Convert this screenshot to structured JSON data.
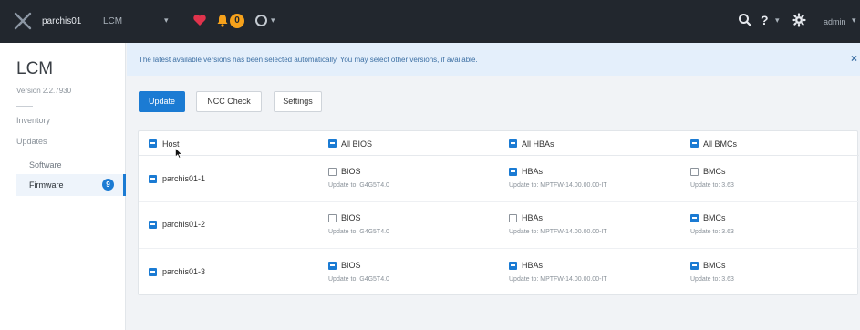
{
  "topbar": {
    "cluster_name": "parchis01",
    "app_name": "LCM",
    "alert_count": "0",
    "help_label": "?",
    "user": "admin"
  },
  "sidebar": {
    "title": "LCM",
    "version": "Version 2.2.7930",
    "nav": {
      "inventory": "Inventory",
      "updates": "Updates",
      "software": "Software",
      "firmware": "Firmware",
      "firmware_badge": "9"
    }
  },
  "banner": {
    "message": "The latest available versions has been selected automatically. You may select other versions, if available.",
    "close": "×"
  },
  "actions": {
    "update": "Update",
    "ncc_check": "NCC Check",
    "settings": "Settings"
  },
  "table": {
    "header": {
      "host": {
        "label": "Host",
        "checked": true
      },
      "bios": {
        "label": "All BIOS",
        "checked": true
      },
      "hbas": {
        "label": "All HBAs",
        "checked": true
      },
      "bmcs": {
        "label": "All BMCs",
        "checked": true
      }
    },
    "rows": [
      {
        "host": {
          "label": "parchis01-1",
          "checked": true
        },
        "bios": {
          "label": "BIOS",
          "checked": false,
          "update": "Update to: G4G5T4.0"
        },
        "hbas": {
          "label": "HBAs",
          "checked": true,
          "update": "Update to: MPTFW-14.00.00.00-IT"
        },
        "bmcs": {
          "label": "BMCs",
          "checked": false,
          "update": "Update to: 3.63"
        }
      },
      {
        "host": {
          "label": "parchis01-2",
          "checked": true
        },
        "bios": {
          "label": "BIOS",
          "checked": false,
          "update": "Update to: G4G5T4.0"
        },
        "hbas": {
          "label": "HBAs",
          "checked": false,
          "update": "Update to: MPTFW-14.00.00.00-IT"
        },
        "bmcs": {
          "label": "BMCs",
          "checked": true,
          "update": "Update to: 3.63"
        }
      },
      {
        "host": {
          "label": "parchis01-3",
          "checked": true
        },
        "bios": {
          "label": "BIOS",
          "checked": true,
          "update": "Update to: G4G5T4.0"
        },
        "hbas": {
          "label": "HBAs",
          "checked": true,
          "update": "Update to: MPTFW-14.00.00.00-IT"
        },
        "bmcs": {
          "label": "BMCs",
          "checked": true,
          "update": "Update to: 3.63"
        }
      }
    ]
  },
  "colors": {
    "accent": "#1b7bd3",
    "topbar": "#22272e",
    "alert": "#f7a21b",
    "heart": "#e0334c"
  }
}
